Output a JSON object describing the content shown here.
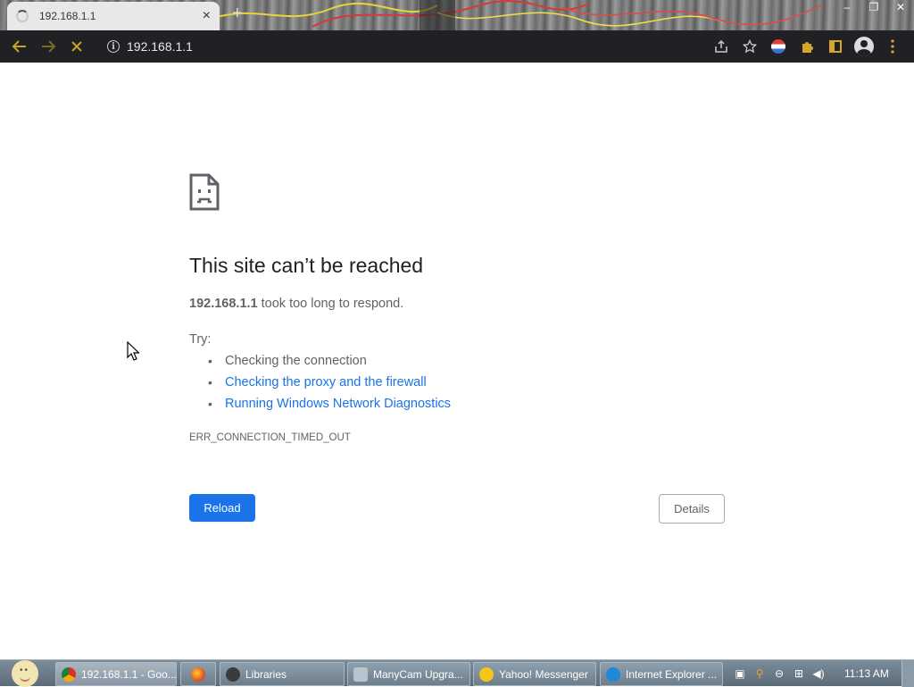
{
  "browser": {
    "tab": {
      "title": "192.168.1.1",
      "close": "×"
    },
    "new_tab": "+",
    "window_controls": [
      "–",
      "❐",
      "✕"
    ],
    "address": "192.168.1.1"
  },
  "error": {
    "title": "This site can’t be reached",
    "host": "192.168.1.1",
    "description": " took too long to respond.",
    "try_label": "Try:",
    "suggestions": [
      "Checking the connection",
      "Checking the proxy and the firewall",
      "Running Windows Network Diagnostics"
    ],
    "code": "ERR_CONNECTION_TIMED_OUT",
    "reload_label": "Reload",
    "details_label": "Details"
  },
  "taskbar": {
    "items": [
      {
        "label": "192.168.1.1 - Goo...",
        "icon": "chrome-icon"
      },
      {
        "label": "",
        "icon": "firefox-icon"
      },
      {
        "label": "Libraries",
        "icon": "folder-icon"
      },
      {
        "label": "ManyCam Upgra...",
        "icon": "manycam-icon"
      },
      {
        "label": "Yahoo! Messenger",
        "icon": "yahoo-messenger-icon"
      },
      {
        "label": "Internet Explorer ...",
        "icon": "internet-explorer-icon"
      }
    ],
    "clock": "11:13 AM"
  },
  "colors": {
    "toolbar_bg": "#202124",
    "accent_link": "#1a73e8",
    "reload_button": "#1a73e8",
    "text_secondary": "#5f6368"
  }
}
